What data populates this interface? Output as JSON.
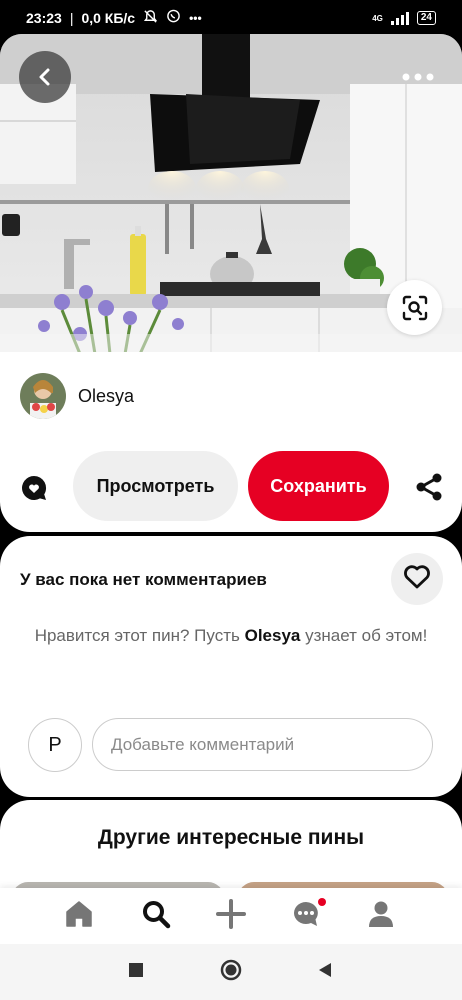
{
  "status_bar": {
    "time": "23:23",
    "speed": "0,0 КБ/с",
    "network": "4G",
    "battery": "24"
  },
  "pin": {
    "author_name": "Olesya"
  },
  "actions": {
    "view_label": "Просмотреть",
    "save_label": "Сохранить",
    "accent_color": "#e60023"
  },
  "comments": {
    "title": "У вас пока нет комментариев",
    "empty_prefix": "Нравится этот пин? Пусть",
    "empty_author": "Olesya",
    "empty_suffix": "узнает об этом!",
    "user_initial": "P",
    "input_placeholder": "Добавьте комментарий"
  },
  "more_pins": {
    "title": "Другие интересные пины"
  },
  "icons": {
    "back": "back-arrow-icon",
    "more": "more-dots-icon",
    "lens": "visual-search-icon",
    "comment": "comment-bubble-icon",
    "share": "share-icon",
    "heart": "heart-icon",
    "nav": [
      "home-icon",
      "search-icon",
      "plus-icon",
      "messages-icon",
      "profile-icon"
    ],
    "system": [
      "recents-square-icon",
      "home-circle-icon",
      "back-triangle-icon"
    ]
  }
}
